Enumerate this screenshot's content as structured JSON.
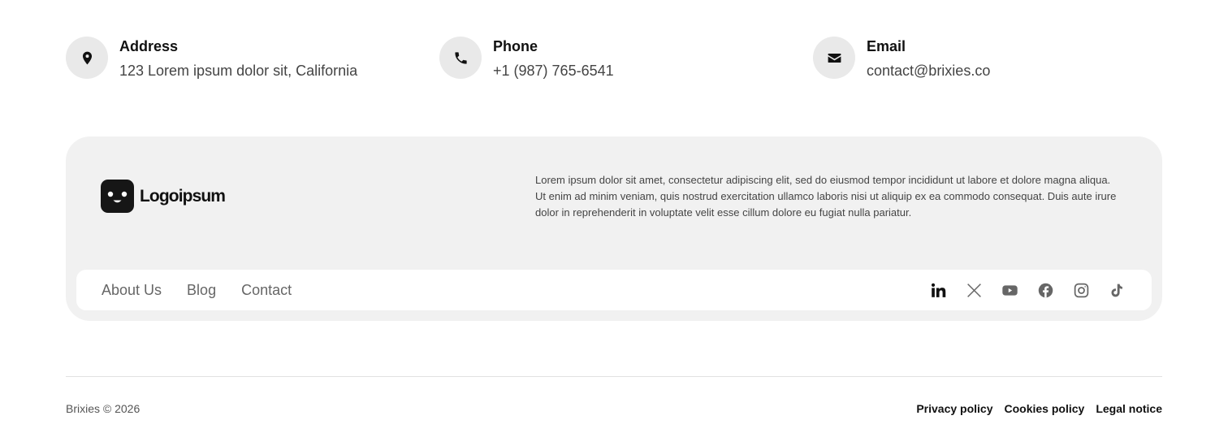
{
  "contacts": [
    {
      "icon": "map-pin-icon",
      "label": "Address",
      "value": "123 Lorem ipsum dolor sit, California"
    },
    {
      "icon": "phone-icon",
      "label": "Phone",
      "value": "+1 (987) 765-6541"
    },
    {
      "icon": "envelope-icon",
      "label": "Email",
      "value": "contact@brixies.co"
    }
  ],
  "footer": {
    "logo_text": "Logoipsum",
    "description": "Lorem ipsum dolor sit amet, consectetur adipiscing elit, sed do eiusmod tempor incididunt ut labore et dolore magna aliqua. Ut enim ad minim veniam, quis nostrud exercitation ullamco laboris nisi ut aliquip ex ea commodo consequat. Duis aute irure dolor in reprehenderit in voluptate velit esse cillum dolore eu fugiat nulla pariatur.",
    "nav": [
      "About Us",
      "Blog",
      "Contact"
    ],
    "socials": [
      "linkedin-icon",
      "x-icon",
      "youtube-icon",
      "facebook-icon",
      "instagram-icon",
      "tiktok-icon"
    ]
  },
  "bottom": {
    "copyright": "Brixies © 2026",
    "links": [
      "Privacy policy",
      "Cookies policy",
      "Legal notice"
    ]
  },
  "colors": {
    "card_bg": "#f1f1f1",
    "icon_circle": "#e9e9e9",
    "text_dark": "#111111",
    "text_muted": "#666666"
  }
}
